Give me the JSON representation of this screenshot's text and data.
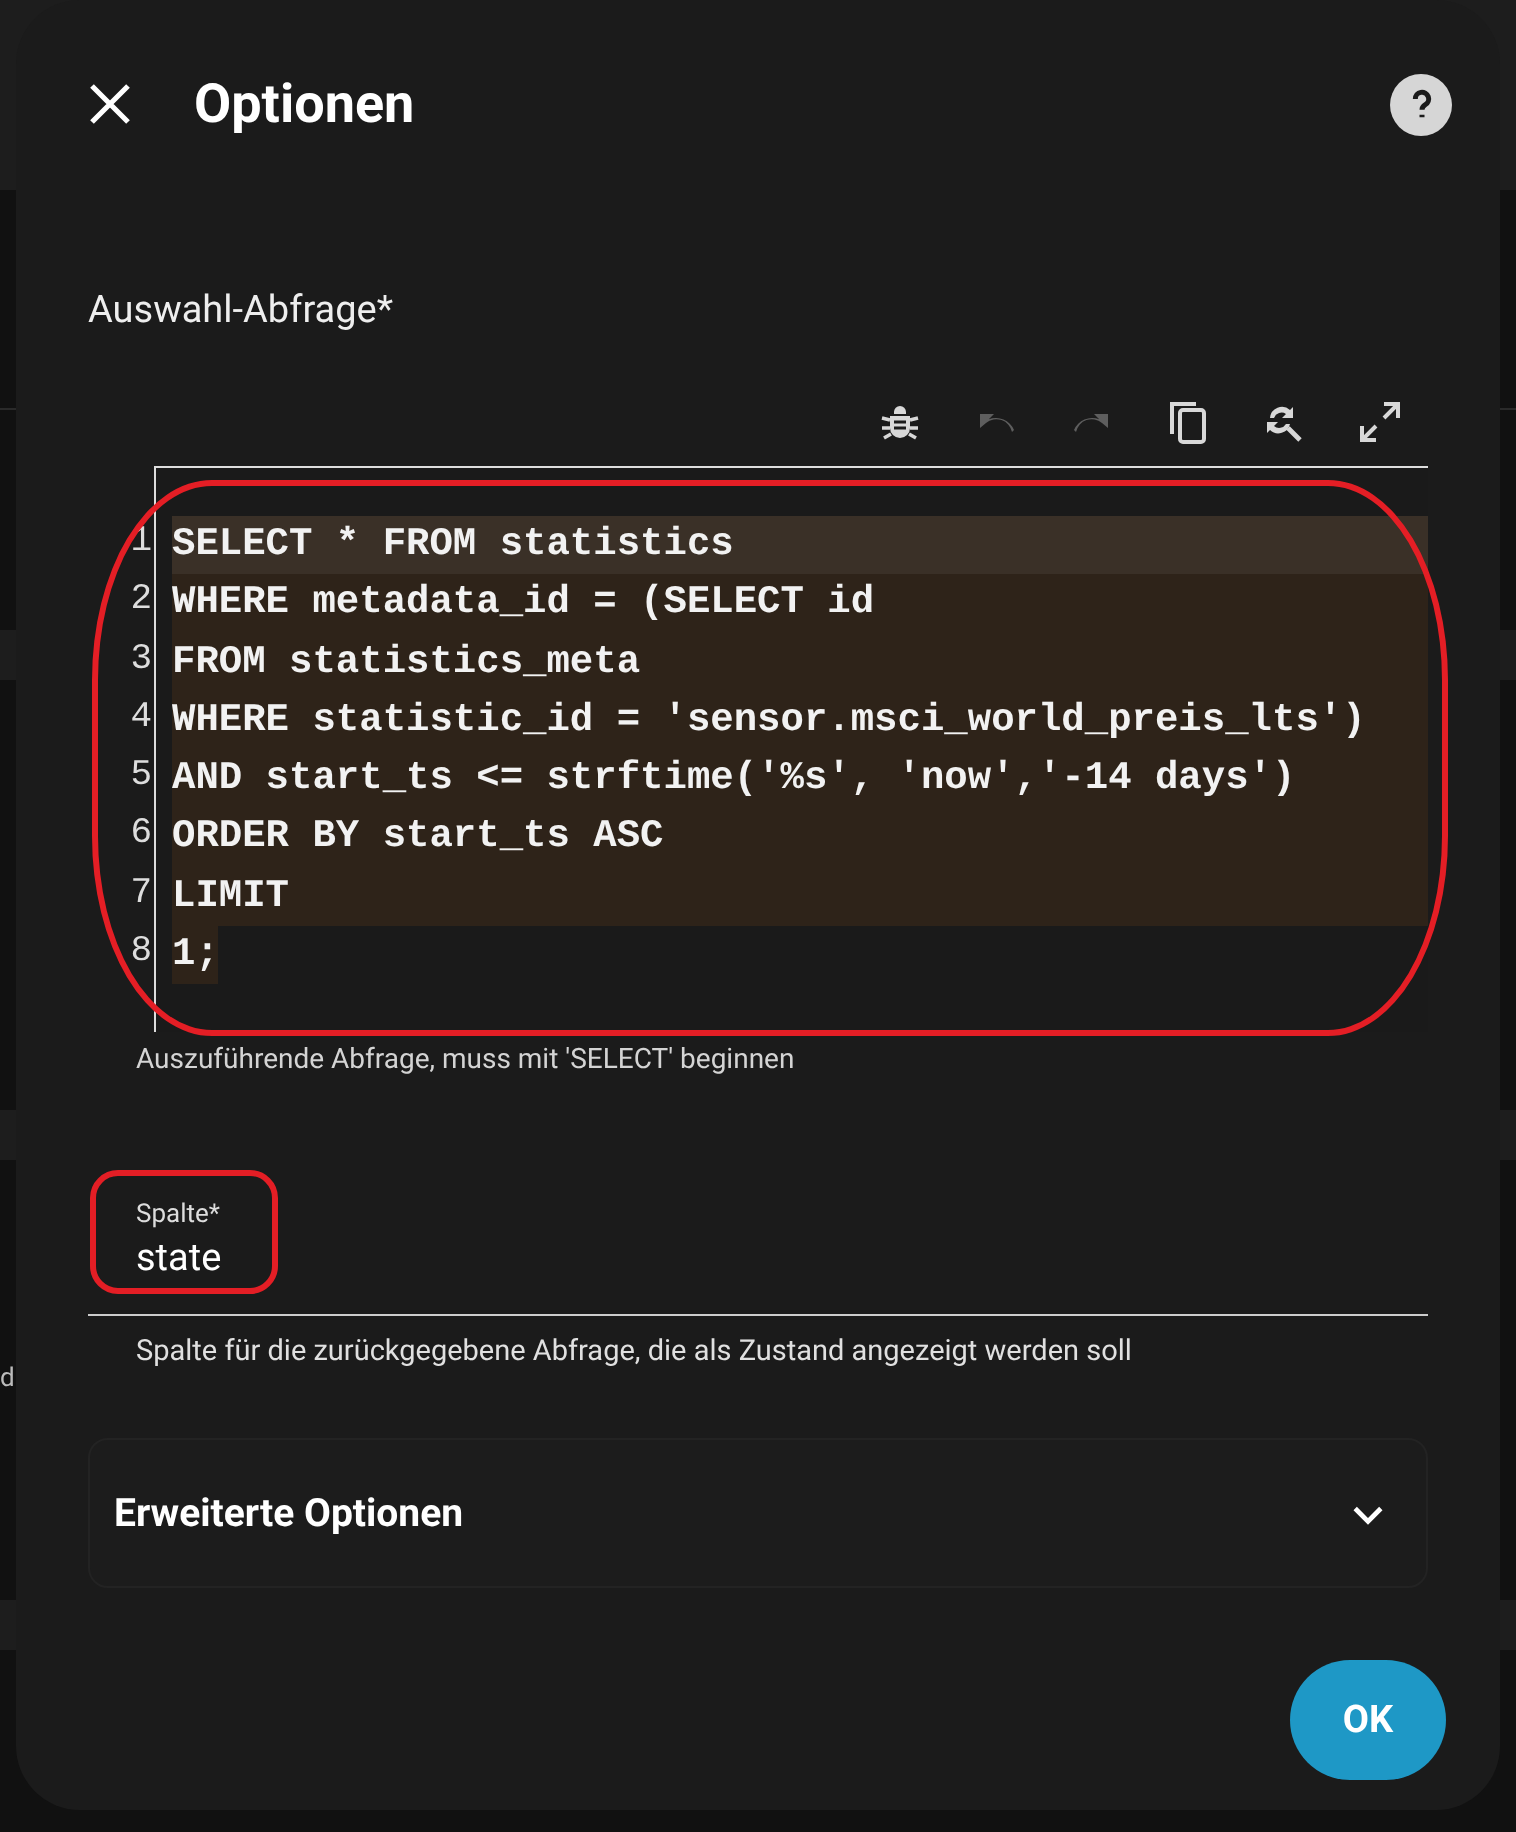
{
  "background_fragments": [
    "d"
  ],
  "dialog": {
    "title": "Optionen"
  },
  "query_field": {
    "label": "Auswahl-Abfrage*",
    "helper": "Auszuführende Abfrage, muss mit 'SELECT' beginnen",
    "toolbar": [
      {
        "kind": "bug",
        "disabled": false
      },
      {
        "kind": "undo",
        "disabled": true
      },
      {
        "kind": "redo",
        "disabled": true
      },
      {
        "kind": "copy",
        "disabled": false
      },
      {
        "kind": "replace",
        "disabled": false
      },
      {
        "kind": "fullscreen",
        "disabled": false
      }
    ],
    "lines": [
      {
        "number": "1",
        "text": "SELECT * FROM statistics",
        "selected": true,
        "current": true
      },
      {
        "number": "2",
        "text": "WHERE metadata_id = (SELECT id",
        "selected": true,
        "current": false
      },
      {
        "number": "3",
        "text": "FROM statistics_meta",
        "selected": true,
        "current": false
      },
      {
        "number": "4",
        "text": "WHERE statistic_id = 'sensor.msci_world_preis_lts')",
        "selected": true,
        "current": false
      },
      {
        "number": "5",
        "text": "AND start_ts <= strftime('%s', 'now','-14 days')",
        "selected": true,
        "current": false
      },
      {
        "number": "6",
        "text": "ORDER BY start_ts ASC",
        "selected": true,
        "current": false
      },
      {
        "number": "7",
        "text": "LIMIT",
        "selected": true,
        "current": false
      },
      {
        "number": "8",
        "text": "1;",
        "selected": true,
        "current": false
      }
    ]
  },
  "column_field": {
    "label": "Spalte*",
    "value": "state",
    "helper": "Spalte für die zurückgegebene Abfrage, die als Zustand angezeigt werden soll"
  },
  "advanced": {
    "label": "Erweiterte Optionen",
    "expanded": false
  },
  "ok_button": "OK"
}
